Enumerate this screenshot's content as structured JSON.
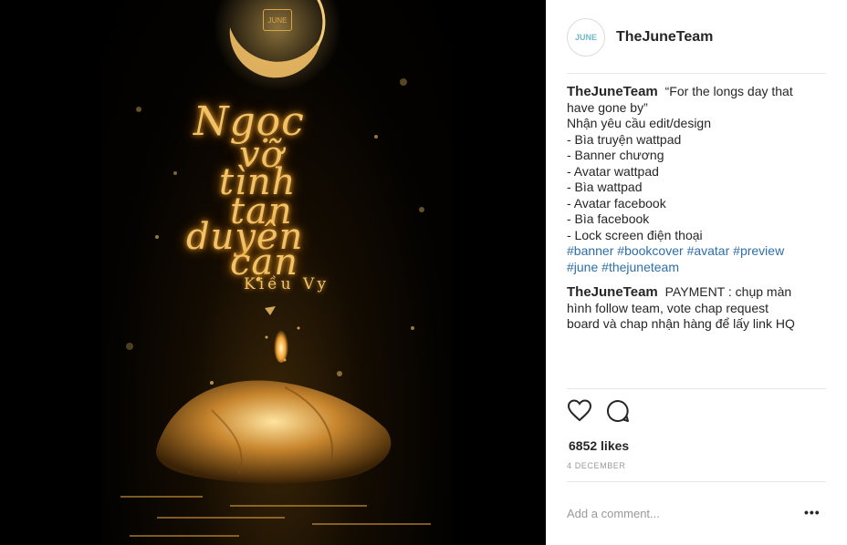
{
  "post": {
    "username": "TheJuneTeam",
    "avatar_icon": "thejuneteam-logo-icon",
    "cover": {
      "title_lines": [
        "Ngọc",
        "vỡ",
        "tình",
        "tan",
        "duyên",
        "cạn"
      ],
      "author": "Kiều Vy"
    },
    "caption": {
      "username": "TheJuneTeam",
      "lines": [
        "“For the longs day that",
        "have gone by”",
        "Nhận yêu cầu edit/design",
        "- Bìa truyện wattpad",
        "- Banner chương",
        "- Avatar wattpad",
        "- Bìa wattpad",
        "- Avatar facebook",
        "- Bìa facebook",
        "- Lock screen điện thoại"
      ],
      "hashtags_line1": [
        "#banner",
        "#bookcover",
        "#avatar",
        "#preview"
      ],
      "hashtags_line2": [
        "#june",
        "#thejuneteam"
      ]
    },
    "comment": {
      "username": "TheJuneTeam",
      "text_lines": [
        "PAYMENT : chụp màn",
        "hình follow team, vote chap request",
        "board và chap nhận hàng để lấy link HQ"
      ]
    },
    "actions": {
      "like_icon": "heart-icon",
      "comment_icon": "speech-bubble-icon"
    },
    "likes": "6852 likes",
    "date": "4 DECEMBER",
    "add_comment_placeholder": "Add a comment...",
    "more_options": "•••"
  },
  "colors": {
    "hashtag": "#2d6fa8",
    "glow": "#f3c266",
    "panel_bg": "#ffffff"
  }
}
